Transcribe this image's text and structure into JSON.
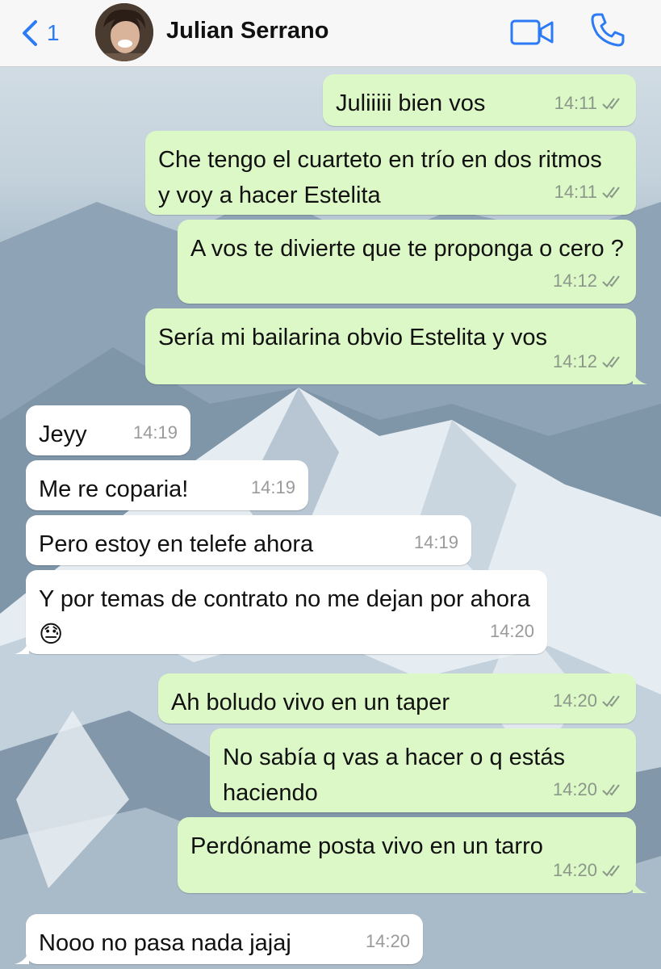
{
  "header": {
    "back_count": "1",
    "contact_name": "Julian Serrano"
  },
  "messages": [
    {
      "direction": "out",
      "text": "Juliiiii bien vos",
      "time": "14:11"
    },
    {
      "direction": "out",
      "text": "Che tengo el cuarteto en trío en dos ritmos y voy a hacer Estelita",
      "time": "14:11"
    },
    {
      "direction": "out",
      "text": "A vos te divierte que te proponga o cero ?",
      "time": "14:12"
    },
    {
      "direction": "out",
      "text": "Sería mi bailarina obvio Estelita y vos",
      "time": "14:12"
    },
    {
      "direction": "in",
      "text": "Jeyy",
      "time": "14:19"
    },
    {
      "direction": "in",
      "text": "Me re coparia!",
      "time": "14:19"
    },
    {
      "direction": "in",
      "text": "Pero estoy en telefe ahora",
      "time": "14:19"
    },
    {
      "direction": "in",
      "text": "Y por temas de contrato no me dejan por ahora 😓",
      "time": "14:20"
    },
    {
      "direction": "out",
      "text": "Ah boludo vivo en un taper",
      "time": "14:20"
    },
    {
      "direction": "out",
      "text": "No sabía q vas a hacer o q estás haciendo",
      "time": "14:20"
    },
    {
      "direction": "out",
      "text": "Perdóname posta vivo en un tarro",
      "time": "14:20"
    },
    {
      "direction": "in",
      "text": "Nooo no pasa nada jajaj",
      "time": "14:20"
    }
  ],
  "colors": {
    "outgoing_bubble": "#dcf8c6",
    "incoming_bubble": "#ffffff",
    "accent": "#2b7bf6",
    "read_ticks": "#8a978a"
  },
  "icons": {
    "back": "chevron-left-icon",
    "video": "video-camera-icon",
    "call": "phone-icon",
    "read": "double-check-icon"
  }
}
